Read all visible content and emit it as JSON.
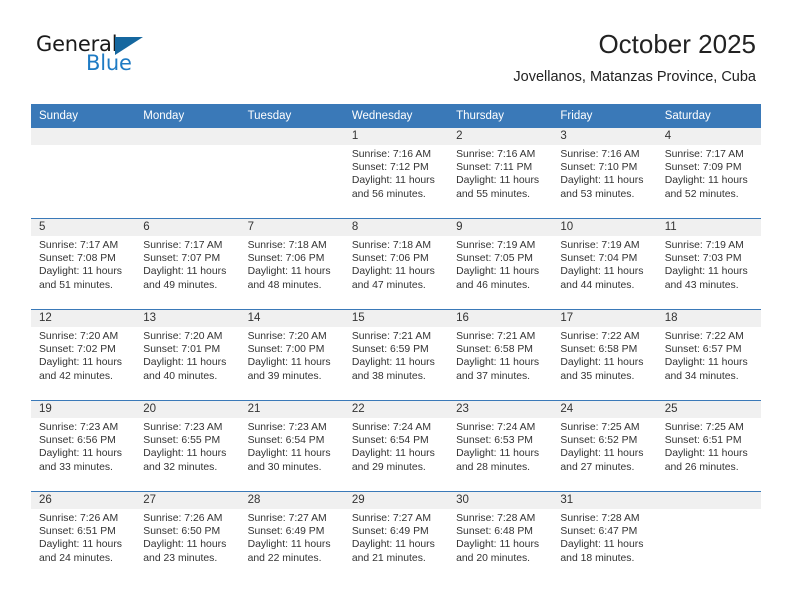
{
  "brand": {
    "name_part1": "General",
    "name_part2": "Blue",
    "accent_color": "#1e7bc4",
    "triangle_color": "#15679f"
  },
  "header": {
    "title": "October 2025",
    "subtitle": "Jovellanos, Matanzas Province, Cuba"
  },
  "calendar": {
    "header_color": "#3a79b8",
    "daynum_band_color": "#f0f0f0",
    "weekday_headers": [
      "Sunday",
      "Monday",
      "Tuesday",
      "Wednesday",
      "Thursday",
      "Friday",
      "Saturday"
    ],
    "weeks": [
      [
        {
          "day": "",
          "lines": []
        },
        {
          "day": "",
          "lines": []
        },
        {
          "day": "",
          "lines": []
        },
        {
          "day": "1",
          "lines": [
            "Sunrise: 7:16 AM",
            "Sunset: 7:12 PM",
            "Daylight: 11 hours",
            "and 56 minutes."
          ]
        },
        {
          "day": "2",
          "lines": [
            "Sunrise: 7:16 AM",
            "Sunset: 7:11 PM",
            "Daylight: 11 hours",
            "and 55 minutes."
          ]
        },
        {
          "day": "3",
          "lines": [
            "Sunrise: 7:16 AM",
            "Sunset: 7:10 PM",
            "Daylight: 11 hours",
            "and 53 minutes."
          ]
        },
        {
          "day": "4",
          "lines": [
            "Sunrise: 7:17 AM",
            "Sunset: 7:09 PM",
            "Daylight: 11 hours",
            "and 52 minutes."
          ]
        }
      ],
      [
        {
          "day": "5",
          "lines": [
            "Sunrise: 7:17 AM",
            "Sunset: 7:08 PM",
            "Daylight: 11 hours",
            "and 51 minutes."
          ]
        },
        {
          "day": "6",
          "lines": [
            "Sunrise: 7:17 AM",
            "Sunset: 7:07 PM",
            "Daylight: 11 hours",
            "and 49 minutes."
          ]
        },
        {
          "day": "7",
          "lines": [
            "Sunrise: 7:18 AM",
            "Sunset: 7:06 PM",
            "Daylight: 11 hours",
            "and 48 minutes."
          ]
        },
        {
          "day": "8",
          "lines": [
            "Sunrise: 7:18 AM",
            "Sunset: 7:06 PM",
            "Daylight: 11 hours",
            "and 47 minutes."
          ]
        },
        {
          "day": "9",
          "lines": [
            "Sunrise: 7:19 AM",
            "Sunset: 7:05 PM",
            "Daylight: 11 hours",
            "and 46 minutes."
          ]
        },
        {
          "day": "10",
          "lines": [
            "Sunrise: 7:19 AM",
            "Sunset: 7:04 PM",
            "Daylight: 11 hours",
            "and 44 minutes."
          ]
        },
        {
          "day": "11",
          "lines": [
            "Sunrise: 7:19 AM",
            "Sunset: 7:03 PM",
            "Daylight: 11 hours",
            "and 43 minutes."
          ]
        }
      ],
      [
        {
          "day": "12",
          "lines": [
            "Sunrise: 7:20 AM",
            "Sunset: 7:02 PM",
            "Daylight: 11 hours",
            "and 42 minutes."
          ]
        },
        {
          "day": "13",
          "lines": [
            "Sunrise: 7:20 AM",
            "Sunset: 7:01 PM",
            "Daylight: 11 hours",
            "and 40 minutes."
          ]
        },
        {
          "day": "14",
          "lines": [
            "Sunrise: 7:20 AM",
            "Sunset: 7:00 PM",
            "Daylight: 11 hours",
            "and 39 minutes."
          ]
        },
        {
          "day": "15",
          "lines": [
            "Sunrise: 7:21 AM",
            "Sunset: 6:59 PM",
            "Daylight: 11 hours",
            "and 38 minutes."
          ]
        },
        {
          "day": "16",
          "lines": [
            "Sunrise: 7:21 AM",
            "Sunset: 6:58 PM",
            "Daylight: 11 hours",
            "and 37 minutes."
          ]
        },
        {
          "day": "17",
          "lines": [
            "Sunrise: 7:22 AM",
            "Sunset: 6:58 PM",
            "Daylight: 11 hours",
            "and 35 minutes."
          ]
        },
        {
          "day": "18",
          "lines": [
            "Sunrise: 7:22 AM",
            "Sunset: 6:57 PM",
            "Daylight: 11 hours",
            "and 34 minutes."
          ]
        }
      ],
      [
        {
          "day": "19",
          "lines": [
            "Sunrise: 7:23 AM",
            "Sunset: 6:56 PM",
            "Daylight: 11 hours",
            "and 33 minutes."
          ]
        },
        {
          "day": "20",
          "lines": [
            "Sunrise: 7:23 AM",
            "Sunset: 6:55 PM",
            "Daylight: 11 hours",
            "and 32 minutes."
          ]
        },
        {
          "day": "21",
          "lines": [
            "Sunrise: 7:23 AM",
            "Sunset: 6:54 PM",
            "Daylight: 11 hours",
            "and 30 minutes."
          ]
        },
        {
          "day": "22",
          "lines": [
            "Sunrise: 7:24 AM",
            "Sunset: 6:54 PM",
            "Daylight: 11 hours",
            "and 29 minutes."
          ]
        },
        {
          "day": "23",
          "lines": [
            "Sunrise: 7:24 AM",
            "Sunset: 6:53 PM",
            "Daylight: 11 hours",
            "and 28 minutes."
          ]
        },
        {
          "day": "24",
          "lines": [
            "Sunrise: 7:25 AM",
            "Sunset: 6:52 PM",
            "Daylight: 11 hours",
            "and 27 minutes."
          ]
        },
        {
          "day": "25",
          "lines": [
            "Sunrise: 7:25 AM",
            "Sunset: 6:51 PM",
            "Daylight: 11 hours",
            "and 26 minutes."
          ]
        }
      ],
      [
        {
          "day": "26",
          "lines": [
            "Sunrise: 7:26 AM",
            "Sunset: 6:51 PM",
            "Daylight: 11 hours",
            "and 24 minutes."
          ]
        },
        {
          "day": "27",
          "lines": [
            "Sunrise: 7:26 AM",
            "Sunset: 6:50 PM",
            "Daylight: 11 hours",
            "and 23 minutes."
          ]
        },
        {
          "day": "28",
          "lines": [
            "Sunrise: 7:27 AM",
            "Sunset: 6:49 PM",
            "Daylight: 11 hours",
            "and 22 minutes."
          ]
        },
        {
          "day": "29",
          "lines": [
            "Sunrise: 7:27 AM",
            "Sunset: 6:49 PM",
            "Daylight: 11 hours",
            "and 21 minutes."
          ]
        },
        {
          "day": "30",
          "lines": [
            "Sunrise: 7:28 AM",
            "Sunset: 6:48 PM",
            "Daylight: 11 hours",
            "and 20 minutes."
          ]
        },
        {
          "day": "31",
          "lines": [
            "Sunrise: 7:28 AM",
            "Sunset: 6:47 PM",
            "Daylight: 11 hours",
            "and 18 minutes."
          ]
        },
        {
          "day": "",
          "lines": []
        }
      ]
    ]
  }
}
